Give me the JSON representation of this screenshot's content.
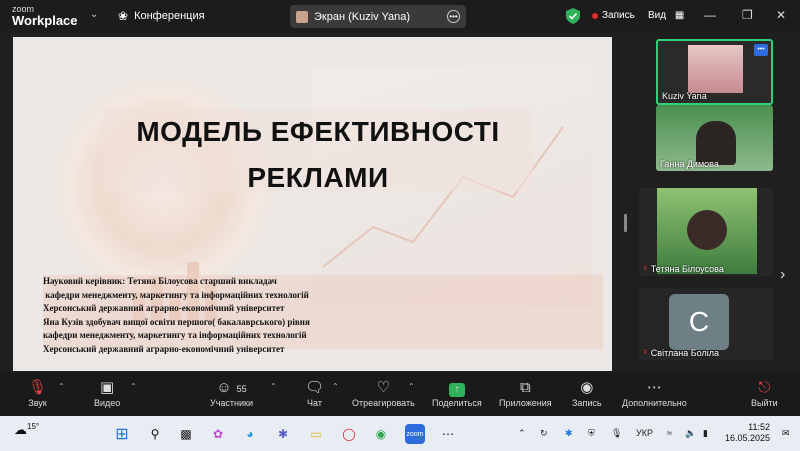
{
  "app": {
    "logo_top": "zoom",
    "logo_bottom": "Workplace",
    "meeting_label": "Конференция"
  },
  "share_pill": {
    "label": "Экран (Kuziv Yana)"
  },
  "record": {
    "label": "Запись"
  },
  "view": {
    "label": "Вид"
  },
  "slide": {
    "title": "МОДЕЛЬ ЕФЕКТИВНОСТІ\nРЕКЛАМИ",
    "credits": "Науковий керівник: Тетяна Білоусова старший викладач\n кафедри менеджменту, маркетингу та інформаційних технологій\nХерсонський державний аграрно-економічний університет\nЯна Кузів здобувач вищої освіти першого( бакалаврського) рівня\nкафедри менеджменту, маркетингу та інформаційних технологій\nХерсонський державний аграрно-економічний університет"
  },
  "participants": [
    {
      "name": "Kuziv Yana"
    },
    {
      "name": "Ганна Димова"
    },
    {
      "name": "Тетяна Білоусова"
    },
    {
      "name": "Світлана Боліла",
      "initial": "С"
    }
  ],
  "toolbar": {
    "audio": "Звук",
    "video": "Видео",
    "participants": "Участники",
    "participants_count": "55",
    "chat": "Чат",
    "react": "Отреагировать",
    "share": "Поделиться",
    "apps": "Приложения",
    "record": "Запись",
    "more": "Дополнительно",
    "leave": "Выйти"
  },
  "taskbar": {
    "weather": "15°",
    "lang": "УКР",
    "time": "11:52",
    "date": "16.05.2025"
  },
  "colors": {
    "accent_green": "#2fb35a",
    "record_red": "#e02f2f",
    "active_border": "#2fd07a"
  }
}
